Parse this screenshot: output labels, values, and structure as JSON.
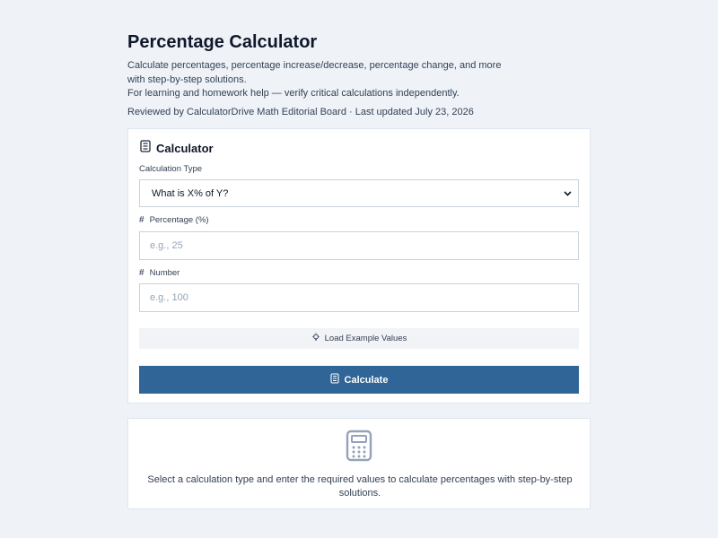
{
  "header": {
    "title": "Percentage Calculator",
    "description_line1": "Calculate percentages, percentage increase/decrease, percentage change, and more",
    "description_line2": "with step-by-step solutions.",
    "description_line3": "For learning and homework help — verify critical calculations independently.",
    "reviewed": "Reviewed by CalculatorDrive Math Editorial Board · Last updated July 23, 2026"
  },
  "calculator": {
    "title": "Calculator",
    "title_icon": "calculator-icon",
    "type_label": "Calculation Type",
    "type_value": "What is X% of Y?",
    "percentage_label": "Percentage (%)",
    "percentage_placeholder": "e.g., 25",
    "percentage_value": "",
    "number_label": "Number",
    "number_placeholder": "e.g., 100",
    "number_value": "",
    "example_button": "Load Example Values",
    "example_icon": "lightbulb-icon",
    "calculate_button": "Calculate",
    "calculate_icon": "calculator-icon"
  },
  "result": {
    "icon": "calculator-icon",
    "message": "Select a calculation type and enter the required values to calculate percentages with step-by-step solutions."
  },
  "colors": {
    "background": "#eff3f8",
    "primary_button": "#2f6597",
    "card": "#ffffff",
    "border": "#dfe5ee"
  }
}
